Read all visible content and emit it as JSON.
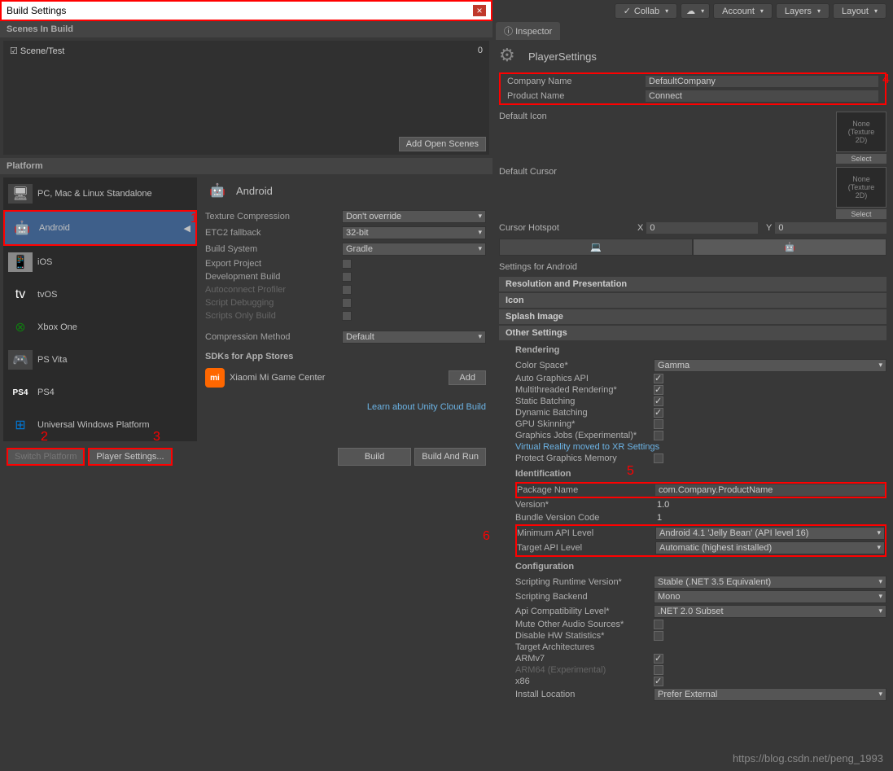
{
  "window": {
    "title": "Build Settings"
  },
  "scenes": {
    "header": "Scenes In Build",
    "items": [
      {
        "name": "Scene/Test",
        "index": "0"
      }
    ],
    "add_button": "Add Open Scenes"
  },
  "platform": {
    "header": "Platform",
    "items": [
      {
        "name": "PC, Mac & Linux Standalone"
      },
      {
        "name": "Android"
      },
      {
        "name": "iOS"
      },
      {
        "name": "tvOS"
      },
      {
        "name": "Xbox One"
      },
      {
        "name": "PS Vita"
      },
      {
        "name": "PS4"
      },
      {
        "name": "Universal Windows Platform"
      }
    ]
  },
  "details": {
    "title": "Android",
    "texture_compression": {
      "label": "Texture Compression",
      "value": "Don't override"
    },
    "etc2": {
      "label": "ETC2 fallback",
      "value": "32-bit"
    },
    "build_system": {
      "label": "Build System",
      "value": "Gradle"
    },
    "export_project": "Export Project",
    "development_build": "Development Build",
    "autoconnect": "Autoconnect Profiler",
    "script_debug": "Script Debugging",
    "scripts_only": "Scripts Only Build",
    "compression_method": {
      "label": "Compression Method",
      "value": "Default"
    },
    "sdk_header": "SDKs for App Stores",
    "xiaomi": "Xiaomi Mi Game Center",
    "add": "Add",
    "cloud_link": "Learn about Unity Cloud Build"
  },
  "buttons": {
    "switch": "Switch Platform",
    "player_settings": "Player Settings...",
    "build": "Build",
    "build_run": "Build And Run"
  },
  "toolbar": {
    "collab": "Collab",
    "account": "Account",
    "layers": "Layers",
    "layout": "Layout"
  },
  "inspector": {
    "tab": "Inspector",
    "title": "PlayerSettings",
    "company": {
      "label": "Company Name",
      "value": "DefaultCompany"
    },
    "product": {
      "label": "Product Name",
      "value": "Connect"
    },
    "default_icon": "Default Icon",
    "default_cursor": "Default Cursor",
    "texture_none": "None\n(Texture 2D)",
    "select": "Select",
    "hotspot": {
      "label": "Cursor Hotspot",
      "x_label": "X",
      "x": "0",
      "y_label": "Y",
      "y": "0"
    },
    "settings_for": "Settings for Android",
    "sections": {
      "resolution": "Resolution and Presentation",
      "icon": "Icon",
      "splash": "Splash Image",
      "other": "Other Settings"
    },
    "rendering": {
      "header": "Rendering",
      "color_space": {
        "label": "Color Space*",
        "value": "Gamma"
      },
      "auto_gfx": "Auto Graphics API",
      "multithread": "Multithreaded Rendering*",
      "static_batch": "Static Batching",
      "dynamic_batch": "Dynamic Batching",
      "gpu_skin": "GPU Skinning*",
      "gfx_jobs": "Graphics Jobs (Experimental)*",
      "vr_link": "Virtual Reality moved to XR Settings",
      "protect_mem": "Protect Graphics Memory"
    },
    "identification": {
      "header": "Identification",
      "package": {
        "label": "Package Name",
        "value": "com.Company.ProductName"
      },
      "version": {
        "label": "Version*",
        "value": "1.0"
      },
      "bundle": {
        "label": "Bundle Version Code",
        "value": "1"
      },
      "min_api": {
        "label": "Minimum API Level",
        "value": "Android 4.1 'Jelly Bean' (API level 16)"
      },
      "target_api": {
        "label": "Target API Level",
        "value": "Automatic (highest installed)"
      }
    },
    "configuration": {
      "header": "Configuration",
      "runtime": {
        "label": "Scripting Runtime Version*",
        "value": "Stable (.NET 3.5 Equivalent)"
      },
      "backend": {
        "label": "Scripting Backend",
        "value": "Mono"
      },
      "api_compat": {
        "label": "Api Compatibility Level*",
        "value": ".NET 2.0 Subset"
      },
      "mute_audio": "Mute Other Audio Sources*",
      "disable_hw": "Disable HW Statistics*",
      "target_arch": "Target Architectures",
      "armv7": "ARMv7",
      "arm64": "ARM64 (Experimental)",
      "x86": "x86",
      "install_loc": {
        "label": "Install Location",
        "value": "Prefer External"
      }
    }
  },
  "annotations": {
    "a1": "1",
    "a2": "2",
    "a3": "3",
    "a4": "4",
    "a5": "5",
    "a6": "6"
  },
  "watermark": "https://blog.csdn.net/peng_1993"
}
